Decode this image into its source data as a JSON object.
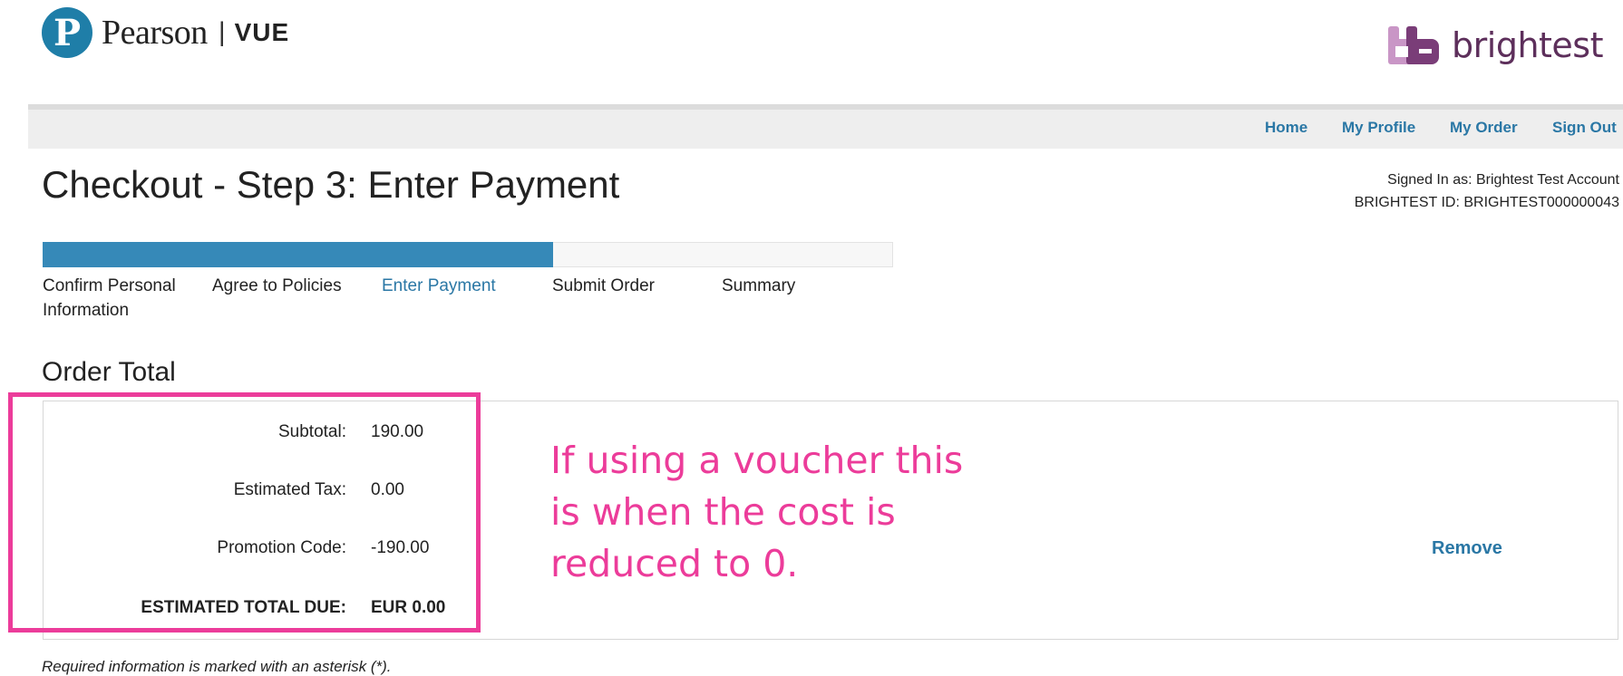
{
  "brand": {
    "pearson_mark": "P",
    "pearson_name": "Pearson",
    "separator": "|",
    "vue": "VUE",
    "partner_name": "brightest"
  },
  "nav": {
    "items": [
      "Home",
      "My Profile",
      "My Order",
      "Sign Out"
    ]
  },
  "page": {
    "title": "Checkout - Step 3: Enter Payment",
    "signed_in": "Signed In as: Brightest Test Account",
    "brightest_id": "BRIGHTEST ID: BRIGHTEST000000043"
  },
  "progress": {
    "fraction": 0.6,
    "steps": [
      {
        "label_line1": "Confirm Personal",
        "label_line2": "Information",
        "active": false
      },
      {
        "label_line1": "Agree to Policies",
        "label_line2": "",
        "active": false
      },
      {
        "label_line1": "Enter Payment",
        "label_line2": "",
        "active": true
      },
      {
        "label_line1": "Submit Order",
        "label_line2": "",
        "active": false
      },
      {
        "label_line1": "Summary",
        "label_line2": "",
        "active": false
      }
    ]
  },
  "order": {
    "section_title": "Order Total",
    "subtotal_label": "Subtotal:",
    "subtotal_value": "190.00",
    "tax_label": "Estimated Tax:",
    "tax_value": "0.00",
    "promo_label": "Promotion Code:",
    "promo_value": "-190.00",
    "total_label": "ESTIMATED TOTAL DUE:",
    "total_value": "EUR 0.00",
    "remove_label": "Remove"
  },
  "annotation": {
    "text": "If using a voucher this is when the cost is reduced to 0.",
    "color": "#ec3c9a"
  },
  "footnote": "Required information is marked with an asterisk (*).",
  "colors": {
    "link": "#2a77a5",
    "progress_fill": "#3689b8",
    "pearson_blue": "#1f7ea8",
    "brightest_purple": "#5d2f5b"
  }
}
